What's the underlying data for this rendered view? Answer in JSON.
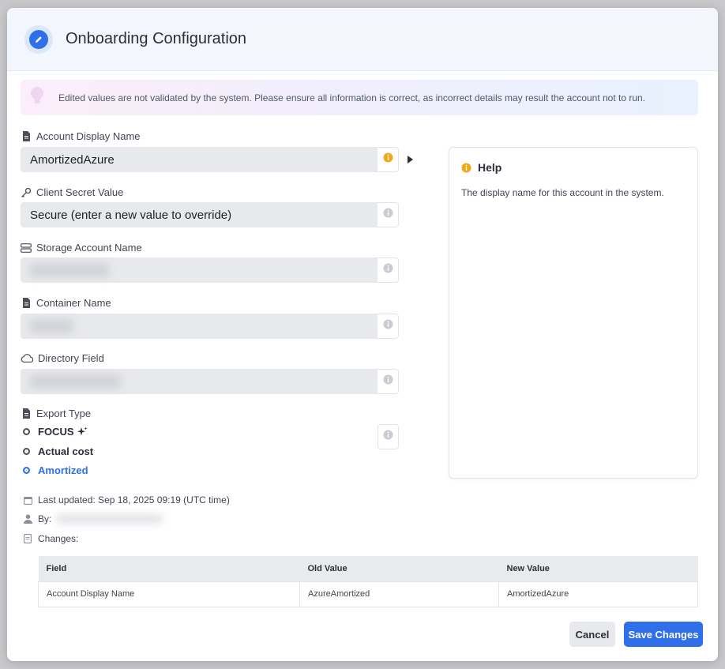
{
  "modal": {
    "title": "Onboarding Configuration",
    "header_icon": "pencil-icon"
  },
  "alert": {
    "icon": "lightbulb-icon",
    "text": "Edited values are not validated by the system. Please ensure all information is correct, as incorrect details may result the account not to run."
  },
  "fields": {
    "display_name": {
      "label": "Account Display Name",
      "icon": "document-icon",
      "value": "AmortizedAzure"
    },
    "client_secret": {
      "label": "Client Secret Value",
      "icon": "key-icon",
      "value": "Secure (enter a new value to override)"
    },
    "storage_account": {
      "label": "Storage Account Name",
      "icon": "storage-icon",
      "value": ""
    },
    "container": {
      "label": "Container Name",
      "icon": "document-icon",
      "value": ""
    },
    "directory": {
      "label": "Directory Field",
      "icon": "cloud-icon",
      "value": ""
    }
  },
  "export_type": {
    "label": "Export Type",
    "icon": "document-icon",
    "options": [
      {
        "label": "FOCUS",
        "selected": false,
        "icon": "sparkle-icon"
      },
      {
        "label": "Actual cost",
        "selected": false
      },
      {
        "label": "Amortized",
        "selected": true
      }
    ]
  },
  "help": {
    "title": "Help",
    "text": "The display name for this account in the system."
  },
  "meta": {
    "last_updated": "Last updated: Sep 18, 2025 09:19 (UTC time)",
    "by_label": "By:",
    "changes_label": "Changes:"
  },
  "changes_table": {
    "headers": [
      "Field",
      "Old Value",
      "New Value"
    ],
    "rows": [
      [
        "Account Display Name",
        "AzureAmortized",
        "AmortizedAzure"
      ]
    ]
  },
  "buttons": {
    "cancel": "Cancel",
    "save": "Save Changes"
  },
  "colors": {
    "accent": "#2f6fea",
    "info_active": "#f0a81b",
    "info_inactive": "#c9ccd2"
  }
}
